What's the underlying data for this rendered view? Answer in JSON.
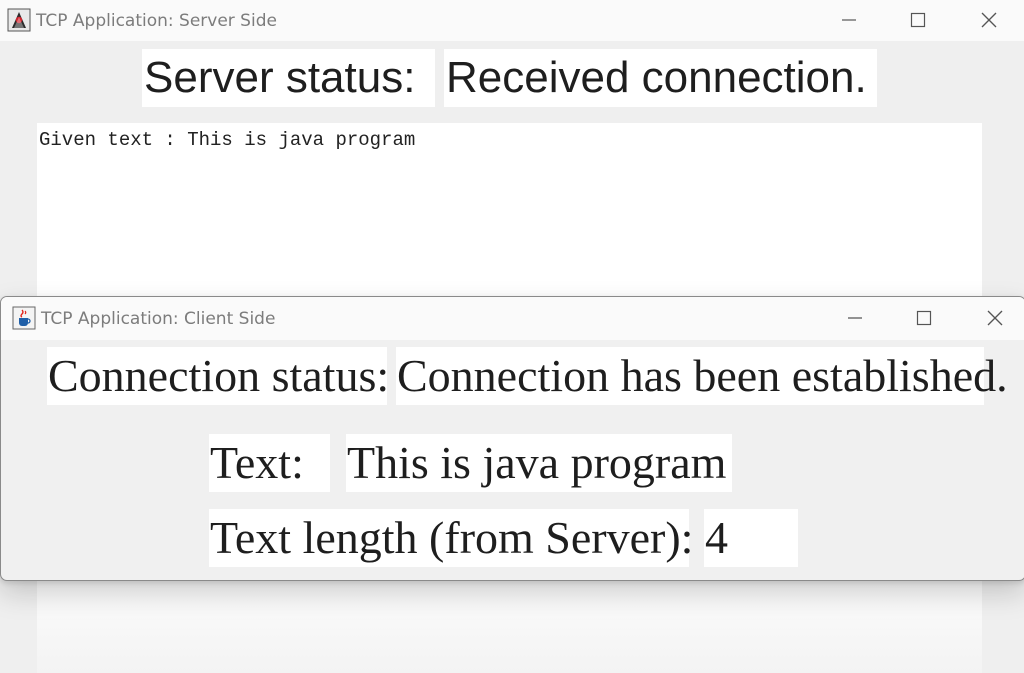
{
  "server_window": {
    "title": "TCP Application: Server Side",
    "status_label": "Server status:",
    "status_value": "Received connection.",
    "textarea_content": "Given text : This is java program"
  },
  "client_window": {
    "title": "TCP Application: Client Side",
    "connection_status_label": "Connection status:",
    "connection_status_value": "Connection has been established.",
    "text_label": "Text:",
    "text_value": "This is java program",
    "length_label": "Text length (from Server):",
    "length_value": "4"
  },
  "icons": {
    "server_app_icon": "java-duke-icon",
    "client_app_icon": "java-coffee-cup-icon",
    "minimize": "minimize-icon",
    "maximize": "maximize-icon",
    "close": "close-icon"
  }
}
